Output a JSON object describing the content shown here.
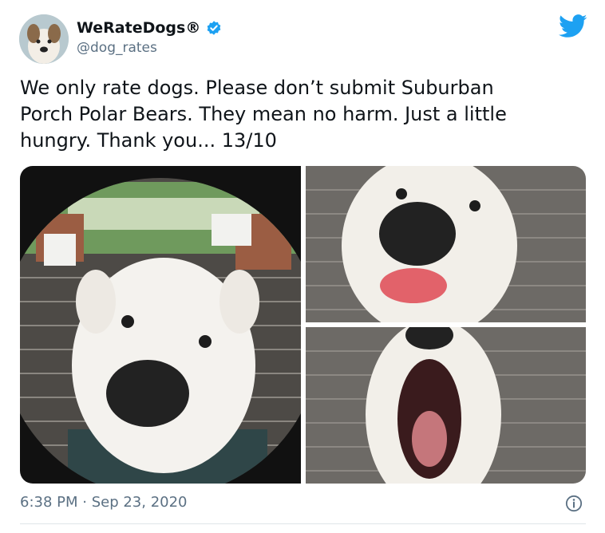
{
  "account": {
    "name": "WeRateDogs®",
    "handle": "@dog_rates",
    "verified": true
  },
  "tweet": {
    "lines": [
      "We only rate dogs. Please don’t submit Suburban",
      "Porch Polar Bears. They mean no harm. Just a little",
      "hungry. Thank you... 13/10"
    ]
  },
  "footer": {
    "timestamp": "6:38 PM · Sep 23, 2020"
  },
  "icons": {
    "verified": "verified-badge-icon",
    "brand": "twitter-bird-icon",
    "info": "info-icon"
  },
  "colors": {
    "brand": "#1da1f2",
    "muted": "#5b7083"
  }
}
